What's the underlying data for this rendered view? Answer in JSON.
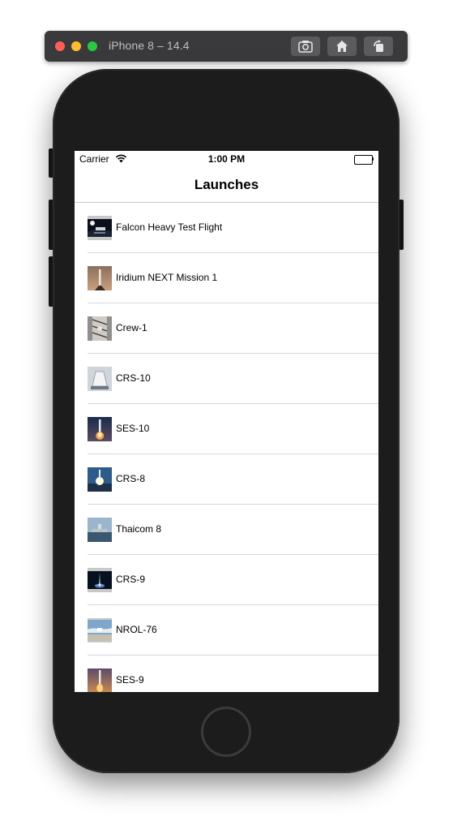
{
  "simulator": {
    "title": "iPhone 8 – 14.4",
    "buttons": [
      {
        "name": "screenshot-icon"
      },
      {
        "name": "home-icon"
      },
      {
        "name": "rotate-icon"
      }
    ]
  },
  "status_bar": {
    "carrier": "Carrier",
    "time": "1:00 PM",
    "wifi_icon": "wifi-icon",
    "battery_icon": "battery-icon"
  },
  "nav": {
    "title": "Launches"
  },
  "launches": [
    {
      "name": "Falcon Heavy Test Flight"
    },
    {
      "name": "Iridium NEXT Mission 1"
    },
    {
      "name": "Crew-1"
    },
    {
      "name": "CRS-10"
    },
    {
      "name": "SES-10"
    },
    {
      "name": "CRS-8"
    },
    {
      "name": "Thaicom 8"
    },
    {
      "name": "CRS-9"
    },
    {
      "name": "NROL-76"
    },
    {
      "name": "SES-9"
    }
  ],
  "colors": {
    "traffic_close": "#fe5f57",
    "traffic_minimize": "#febc2e",
    "traffic_maximize": "#28c840",
    "device_body": "#1c1c1c"
  }
}
